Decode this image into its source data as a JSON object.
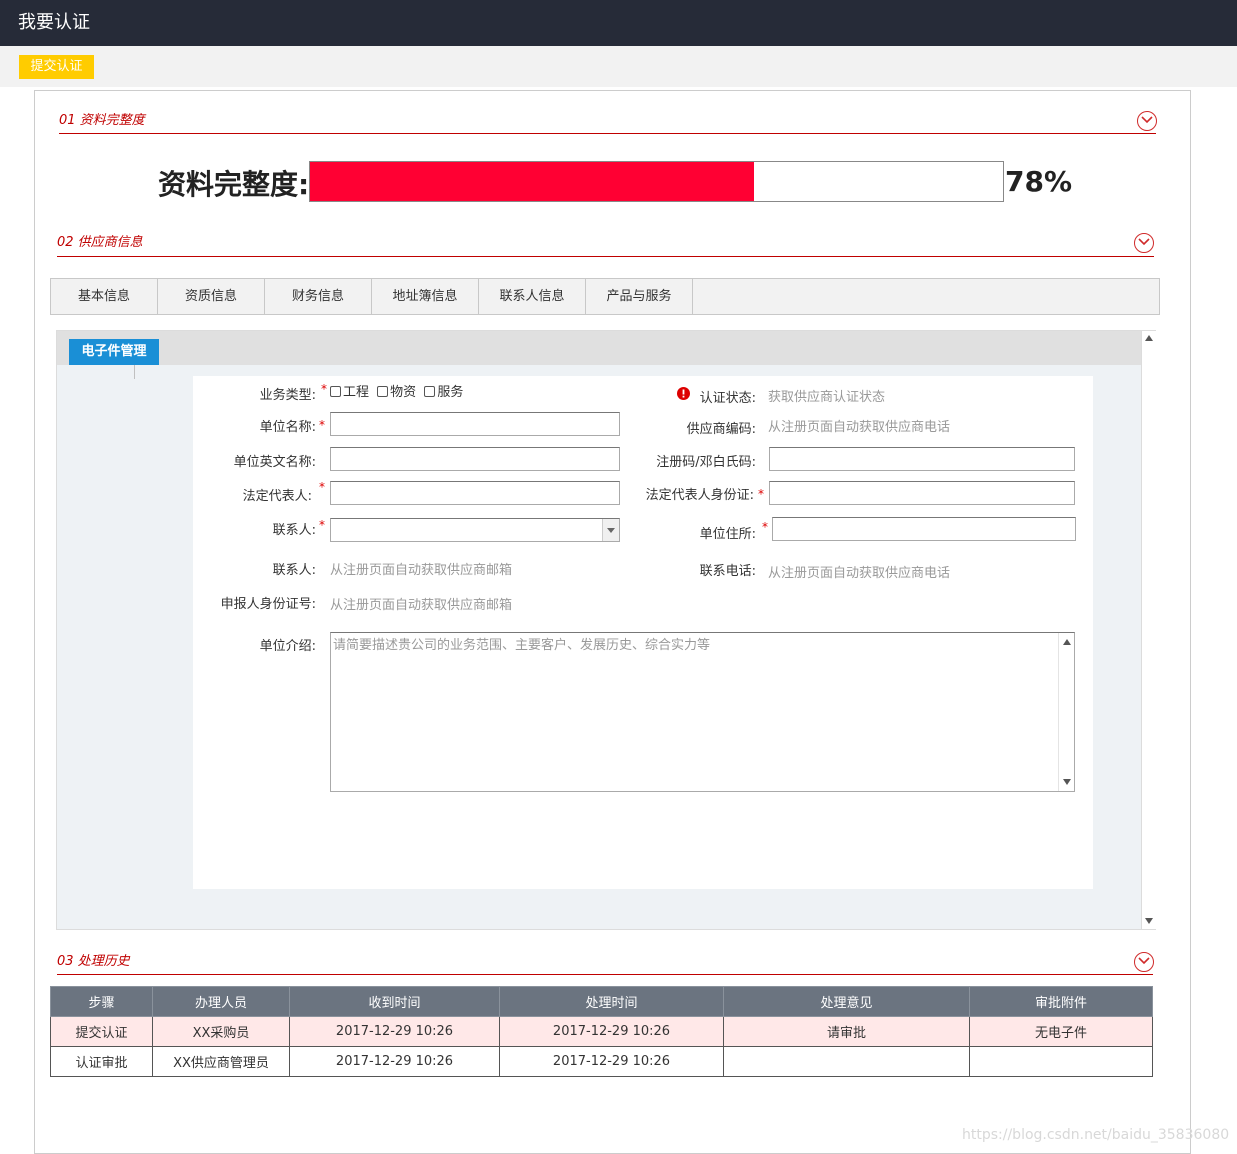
{
  "header": {
    "title": "我要认证"
  },
  "toolbar": {
    "submit_label": "提交认证"
  },
  "sections": {
    "s1": "01 资料完整度",
    "s2": "02 供应商信息",
    "s3": "03 处理历史"
  },
  "progress": {
    "label": "资料完整度:",
    "percent_text": "78%",
    "value": 0.64
  },
  "tabs": [
    "基本信息",
    "资质信息",
    "财务信息",
    "地址簿信息",
    "联系人信息",
    "产品与服务"
  ],
  "subtab": {
    "label": "电子件管理"
  },
  "form": {
    "business_type_label": "业务类型:",
    "business_types": [
      "工程",
      "物资",
      "服务"
    ],
    "cert_status_label": "认证状态:",
    "cert_status_hint": "获取供应商认证状态",
    "unit_name_label": "单位名称:",
    "supplier_code_label": "供应商编码:",
    "supplier_code_hint": "从注册页面自动获取供应商电话",
    "unit_en_name_label": "单位英文名称:",
    "reg_code_label": "注册码/邓白氏码:",
    "legal_rep_label": "法定代表人:",
    "legal_rep_id_label": "法定代表人身份证:",
    "contact_label": "联系人:",
    "unit_address_label": "单位住所:",
    "contact2_label": "联系人:",
    "contact2_hint": "从注册页面自动获取供应商邮箱",
    "phone_label": "联系电话:",
    "phone_hint": "从注册页面自动获取供应商电话",
    "applicant_id_label": "申报人身份证号:",
    "applicant_id_hint": "从注册页面自动获取供应商邮箱",
    "intro_label": "单位介绍:",
    "intro_placeholder": "请简要描述贵公司的业务范围、主要客户、发展历史、综合实力等"
  },
  "history": {
    "headers": [
      "步骤",
      "办理人员",
      "收到时间",
      "处理时间",
      "处理意见",
      "审批附件"
    ],
    "rows": [
      [
        "提交认证",
        "XX采购员",
        "2017-12-29 10:26",
        "2017-12-29 10:26",
        "请审批",
        "无电子件"
      ],
      [
        "认证审批",
        "XX供应商管理员",
        "2017-12-29 10:26",
        "2017-12-29 10:26",
        "",
        ""
      ]
    ]
  },
  "watermark": "https://blog.csdn.net/baidu_35836080",
  "colors": {
    "accent": "#c00000",
    "progress": "#ff0033",
    "submit": "#ffcc00",
    "header_bg": "#262b38",
    "subtab": "#1a8fd6"
  }
}
